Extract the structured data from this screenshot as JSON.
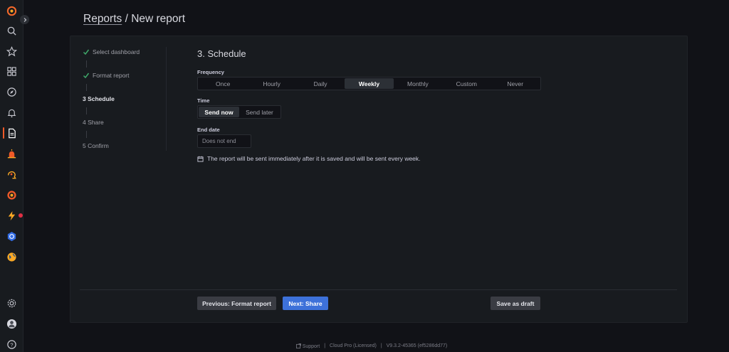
{
  "breadcrumb": {
    "parent": "Reports",
    "separator": " / ",
    "current": "New report"
  },
  "steps": [
    {
      "label": "Select dashboard",
      "state": "done"
    },
    {
      "label": "Format report",
      "state": "done"
    },
    {
      "label": "3 Schedule",
      "state": "current"
    },
    {
      "label": "4 Share",
      "state": "todo"
    },
    {
      "label": "5 Confirm",
      "state": "todo"
    }
  ],
  "section": {
    "title": "3. Schedule"
  },
  "frequency": {
    "label": "Frequency",
    "options": [
      "Once",
      "Hourly",
      "Daily",
      "Weekly",
      "Monthly",
      "Custom",
      "Never"
    ],
    "selected": "Weekly"
  },
  "time": {
    "label": "Time",
    "options": [
      "Send now",
      "Send later"
    ],
    "selected": "Send now"
  },
  "end_date": {
    "label": "End date",
    "placeholder": "Does not end"
  },
  "info": {
    "text": "The report will be sent immediately after it is saved and will be sent every week."
  },
  "buttons": {
    "previous": "Previous: Format report",
    "next": "Next: Share",
    "save_draft": "Save as draft"
  },
  "footer": {
    "support": "Support",
    "license": "Cloud Pro (Licensed)",
    "version": "V9.3.2-45365 (ef5286dd77)",
    "divider": "|"
  },
  "colors": {
    "accent": "#3d71d9",
    "active_nav": "#f05a28",
    "check": "#3fa86a",
    "background": "#111217",
    "panel": "#181b1f"
  },
  "nav_icons": [
    "grafana-logo-icon",
    "search-icon",
    "star-icon",
    "dashboards-icon",
    "explore-icon",
    "alerting-bell-icon",
    "reports-icon",
    "oncall-icon",
    "ml-icon",
    "incident-icon",
    "k6-icon",
    "kubernetes-icon",
    "earth-icon",
    "gear-icon",
    "user-avatar-icon",
    "help-icon"
  ]
}
